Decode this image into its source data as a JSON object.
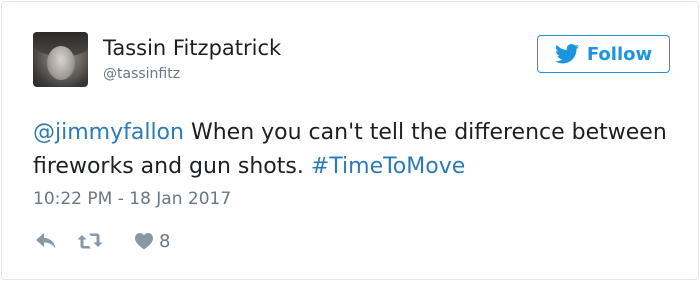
{
  "author": {
    "name": "Tassin Fitzpatrick",
    "handle": "@tassinfitz"
  },
  "follow_button": {
    "label": "Follow",
    "icon": "twitter-bird-icon",
    "color": "#1b95e0"
  },
  "tweet": {
    "mention": "@jimmyfallon",
    "text": " When you can't tell the difference between fireworks and gun shots. ",
    "hashtag": "#TimeToMove",
    "timestamp": "10:22 PM - 18 Jan 2017"
  },
  "actions": {
    "reply_icon": "reply-icon",
    "retweet_icon": "retweet-icon",
    "like_icon": "heart-icon",
    "like_count": "8"
  },
  "colors": {
    "text": "#1c2022",
    "link": "#2b7bb9",
    "muted": "#697882",
    "border": "#e1e8ed"
  }
}
